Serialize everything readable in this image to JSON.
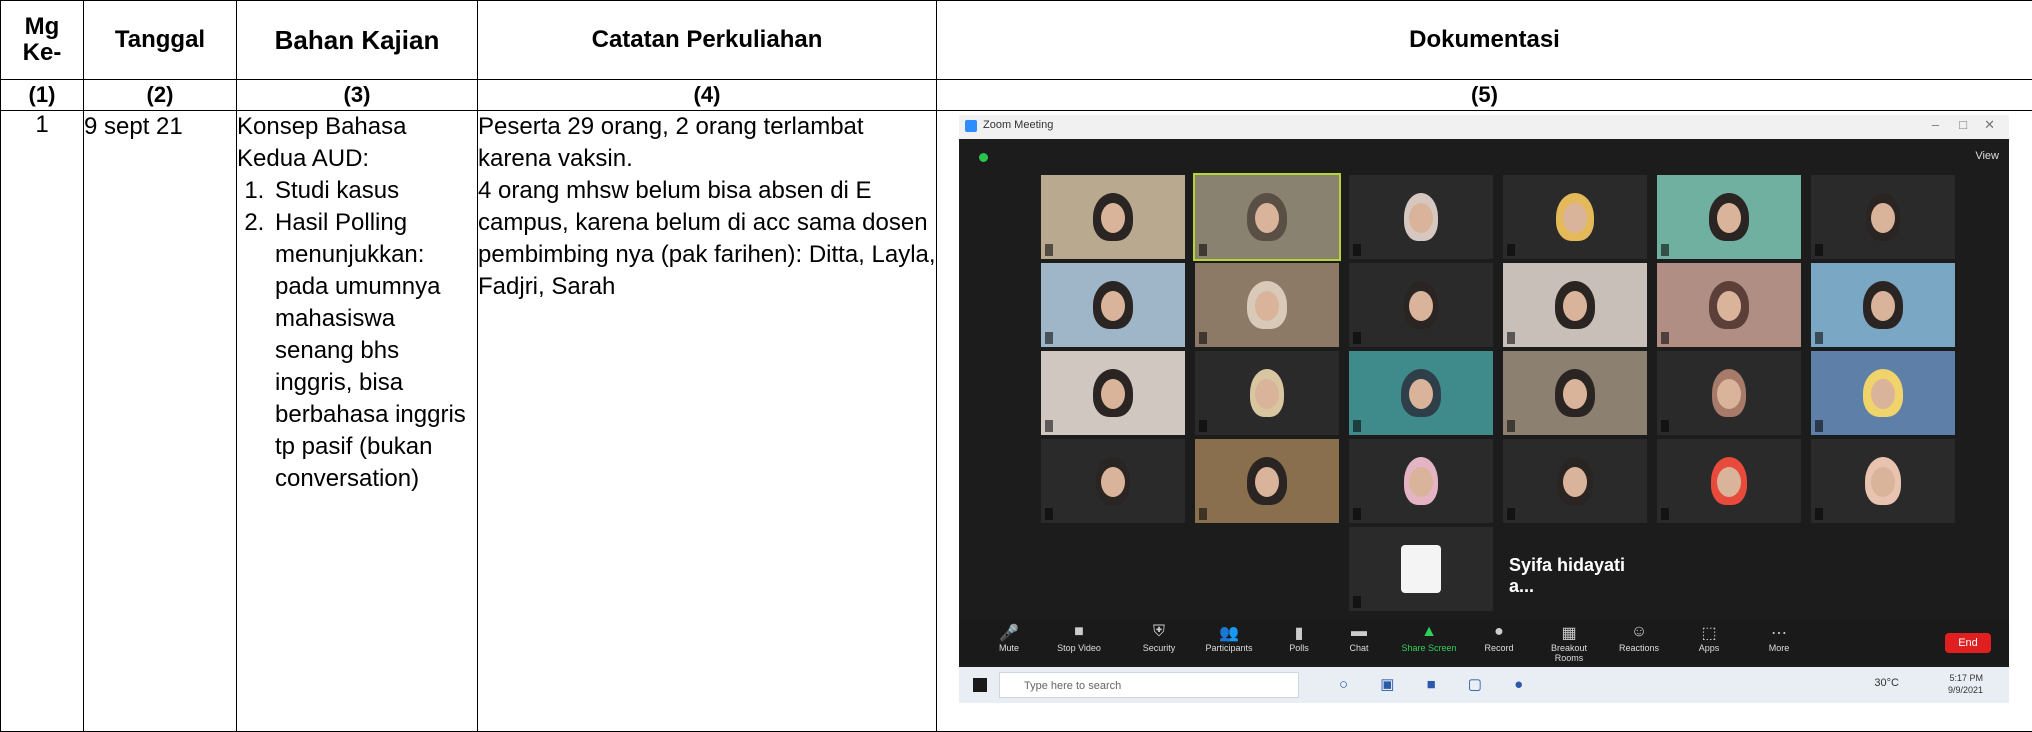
{
  "header": {
    "col1": "Mg Ke-",
    "col1_line1": "Mg",
    "col1_line2": "Ke-",
    "col2": "Tanggal",
    "col3": "Bahan Kajian",
    "col4": "Catatan Perkuliahan",
    "col5": "Dokumentasi"
  },
  "numbering": [
    "(1)",
    "(2)",
    "(3)",
    "(4)",
    "(5)"
  ],
  "rows": [
    {
      "meeting": "1",
      "date": "9 sept 21",
      "topic_title": "Konsep Bahasa Kedua AUD:",
      "topic_items": [
        "Studi kasus",
        "Hasil Polling menunjukkan: pada umumnya mahasiswa senang bhs inggris, bisa berbahasa inggris tp pasif (bukan conversation)"
      ],
      "notes": "Peserta 29 orang, 2 orang terlambat karena vaksin.\n4 orang mhsw belum bisa absen di E campus, karena belum di acc sama dosen pembimbing nya (pak farihen): Ditta, Layla, Fadjri, Sarah"
    }
  ],
  "screenshot": {
    "window_title": "Zoom Meeting",
    "view_label": "View",
    "speaker_label": "Syifa hidayati a...",
    "controls": [
      "Mute",
      "Stop Video",
      "Security",
      "Participants",
      "Polls",
      "Chat",
      "Share Screen",
      "Record",
      "Breakout Rooms",
      "Reactions",
      "Apps",
      "More"
    ],
    "end_label": "End",
    "search_placeholder": "Type here to search",
    "temperature": "30°C",
    "time": "5:17 PM",
    "date": "9/9/2021"
  }
}
